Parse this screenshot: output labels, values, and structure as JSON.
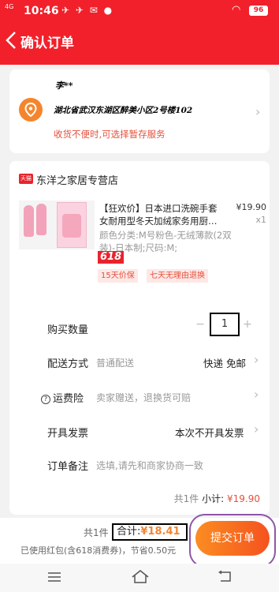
{
  "status_bar": {
    "time": "10:46",
    "signal": "4G",
    "battery": "96"
  },
  "header": {
    "title": "确认订单"
  },
  "address": {
    "name": "李**",
    "detail": "湖北省武汉东湖区醉美小区2号楼102",
    "tip": "收货不便时,可选择暂存服务"
  },
  "shop": {
    "badge": "天猫",
    "name": "东洋之家居专营店"
  },
  "product": {
    "title": "【狂欢价】日本进口洗碗手套女耐用型冬天加绒家务用厨…",
    "price": "¥19.90",
    "quantity": "x1",
    "spec": "颜色分类:M号粉色-无绒薄款(2双装)-日本制;尺码:M;",
    "promo_badge": "618",
    "tags": [
      "15天价保",
      "七天无理由退换"
    ]
  },
  "rows": {
    "quantity_label": "购买数量",
    "quantity_value": "1",
    "delivery_label": "配送方式",
    "delivery_hint": "普通配送",
    "delivery_value": "快递 免邮",
    "insurance_label": "运费险",
    "insurance_hint": "卖家赠送，退换货可赔",
    "invoice_label": "开具发票",
    "invoice_value": "本次不开具发票",
    "remark_label": "订单备注",
    "remark_placeholder": "选填,请先和商家协商一致"
  },
  "subtotal": {
    "count": "共1件",
    "label": "小计:",
    "amount": "¥19.90"
  },
  "footer": {
    "count": "共1件",
    "total_label": "合计:",
    "total_amount": "¥18.41",
    "discount_note": "已使用红包(含618消费券)，节省0.50元",
    "submit_label": "提交订单"
  },
  "colors": {
    "brand_red": "#f2202a",
    "accent_orange": "#f5852d",
    "price_red": "#e5503c"
  }
}
